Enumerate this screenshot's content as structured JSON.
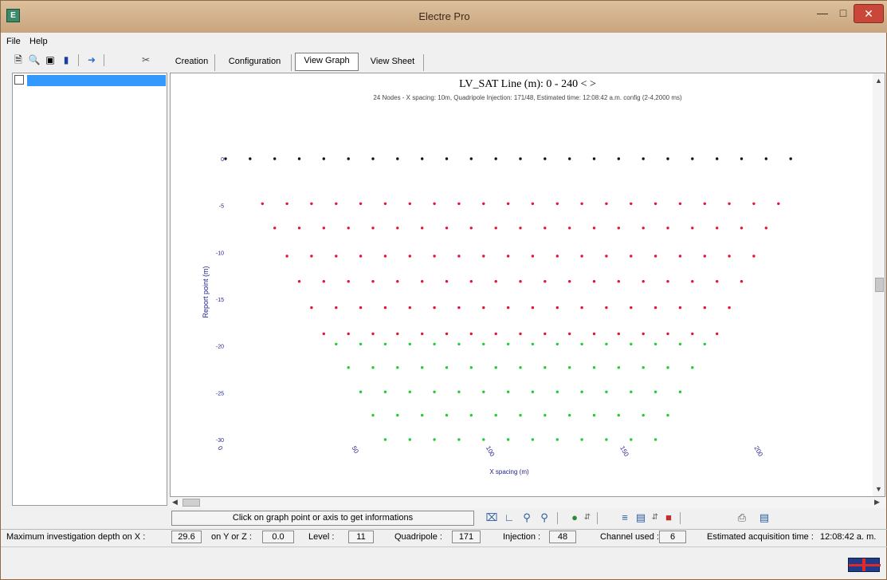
{
  "window": {
    "title": "Electre Pro",
    "icon": "app-logo-icon"
  },
  "menu": [
    {
      "label": "File"
    },
    {
      "label": "Help"
    }
  ],
  "toolbar": {
    "icons": [
      "new-file-icon",
      "open-icon",
      "save-icon",
      "device-icon",
      "import-icon",
      "delete-icon"
    ]
  },
  "tabs": [
    {
      "label": "Creation",
      "active": false
    },
    {
      "label": "Configuration",
      "active": false
    },
    {
      "label": "View Graph",
      "active": true
    },
    {
      "label": "View Sheet",
      "active": false
    }
  ],
  "graph": {
    "title": "LV_SAT   Line (m): 0 - 240 < >",
    "subtitle": "24 Nodes - X spacing: 10m, Quadripole Injection: 171/48, Estimated time: 12:08:42 a.m. config (2-4,2000 ms)",
    "x_axis_label": "X spacing (m)",
    "y_axis_label": "Report point (m)",
    "x_ticks": [
      "0",
      "50",
      "100",
      "150",
      "200"
    ],
    "y_ticks": [
      "0",
      "-5",
      "-10",
      "-15",
      "-20",
      "-25",
      "-30"
    ]
  },
  "chart_data": {
    "type": "scatter",
    "xlabel": "X spacing (m)",
    "ylabel": "Report point (m)",
    "xlim": [
      0,
      240
    ],
    "ylim": [
      -30,
      0
    ],
    "grid": false,
    "series": [
      {
        "color": "#111111",
        "rows": [
          {
            "y": 0,
            "x_start": 0,
            "count": 24,
            "step": 10
          }
        ]
      },
      {
        "color": "#e8113a",
        "rows": [
          {
            "y": -4.8,
            "x_start": 15,
            "count": 22,
            "step": 10
          },
          {
            "y": -7.4,
            "x_start": 20,
            "count": 21,
            "step": 10
          },
          {
            "y": -10.4,
            "x_start": 25,
            "count": 20,
            "step": 10
          },
          {
            "y": -13.1,
            "x_start": 30,
            "count": 19,
            "step": 10
          },
          {
            "y": -15.9,
            "x_start": 35,
            "count": 18,
            "step": 10
          },
          {
            "y": -18.7,
            "x_start": 40,
            "count": 2,
            "step": 10
          },
          {
            "y": -18.7,
            "x_start": 60,
            "count": 15,
            "step": 10
          }
        ]
      },
      {
        "color": "#22cc33",
        "rows": [
          {
            "y": -19.8,
            "x_start": 45,
            "count": 16,
            "step": 10
          },
          {
            "y": -22.3,
            "x_start": 50,
            "count": 15,
            "step": 10
          },
          {
            "y": -24.9,
            "x_start": 55,
            "count": 14,
            "step": 10
          },
          {
            "y": -27.4,
            "x_start": 60,
            "count": 13,
            "step": 10
          },
          {
            "y": -30.0,
            "x_start": 65,
            "count": 12,
            "step": 10
          }
        ]
      }
    ]
  },
  "graph_toolbar": {
    "info_text": "Click on graph point or axis to get informations",
    "icons": [
      "zoom-fit-icon",
      "axis-icon",
      "zoom-in-icon",
      "zoom-out-icon",
      "color-icon",
      "spin-icon",
      "layout-icon",
      "print-preview-icon",
      "config-icon",
      "print-icon",
      "export-icon"
    ]
  },
  "status": {
    "max_depth_label": "Maximum investigation depth on X :",
    "max_depth_x": "29.6",
    "on_yz_label": "on Y or Z :",
    "on_yz_value": "0.0",
    "level_label": "Level :",
    "level_value": "11",
    "quadripole_label": "Quadripole :",
    "quadripole_value": "171",
    "injection_label": "Injection :",
    "injection_value": "48",
    "channel_label": "Channel used :",
    "channel_value": "6",
    "est_time_label": "Estimated acquisition time :",
    "est_time_value": "12:08:42 a. m."
  },
  "colors": {
    "title_bar": "#c9a57e",
    "selection": "#3399ff",
    "axis_text": "#1e1e8c"
  }
}
